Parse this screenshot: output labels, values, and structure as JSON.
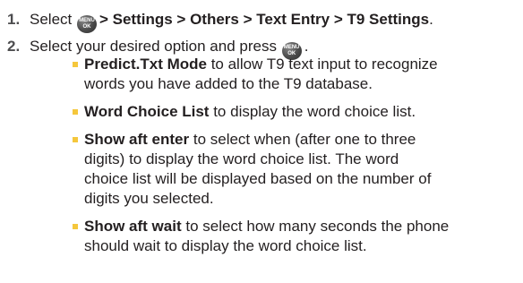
{
  "step1": {
    "number": "1.",
    "prefix": "Select",
    "menu_key": {
      "icon": "menu-ok-key-icon",
      "top": "MENU",
      "bottom": "OK"
    },
    "path": "> Settings > Others > Text Entry > T9 Settings",
    "suffix": "."
  },
  "step2": {
    "number": "2.",
    "text": "Select your desired option and press",
    "suffix": ".",
    "options": [
      {
        "name": "Predict.Txt Mode",
        "lines": [
          " to allow T9 text input to recognize",
          "words you have added to the T9 database."
        ]
      },
      {
        "name": "Word Choice List",
        "lines": [
          " to display the word choice list."
        ]
      },
      {
        "name": "Show aft enter",
        "lines": [
          " to select when (after one to three",
          "digits) to display the word choice list. The word",
          "choice list will be displayed based on the number of",
          "digits you selected."
        ]
      },
      {
        "name": "Show aft wait",
        "lines": [
          " to select how many seconds the phone",
          "should wait to display the word choice list."
        ]
      }
    ]
  },
  "colors": {
    "bullet": "#f5c73c",
    "text": "#231f20",
    "step_number": "#4d4d4f"
  }
}
